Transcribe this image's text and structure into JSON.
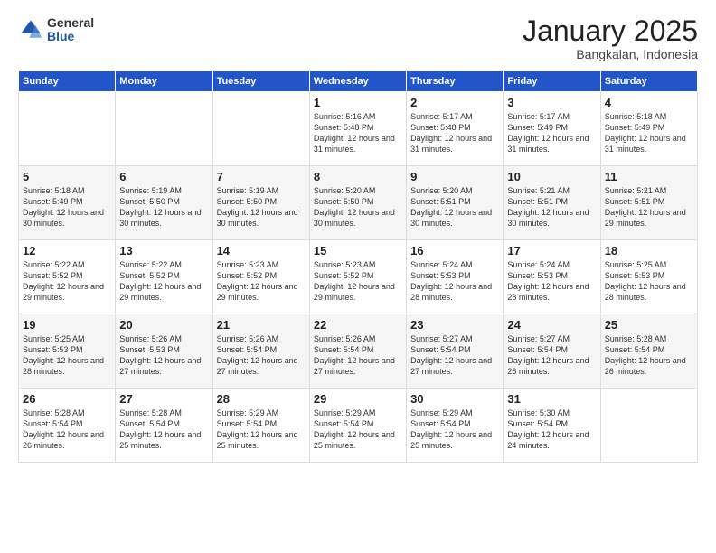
{
  "header": {
    "logo_general": "General",
    "logo_blue": "Blue",
    "title": "January 2025",
    "subtitle": "Bangkalan, Indonesia"
  },
  "weekdays": [
    "Sunday",
    "Monday",
    "Tuesday",
    "Wednesday",
    "Thursday",
    "Friday",
    "Saturday"
  ],
  "weeks": [
    [
      {
        "day": "",
        "info": ""
      },
      {
        "day": "",
        "info": ""
      },
      {
        "day": "",
        "info": ""
      },
      {
        "day": "1",
        "info": "Sunrise: 5:16 AM\nSunset: 5:48 PM\nDaylight: 12 hours\nand 31 minutes."
      },
      {
        "day": "2",
        "info": "Sunrise: 5:17 AM\nSunset: 5:48 PM\nDaylight: 12 hours\nand 31 minutes."
      },
      {
        "day": "3",
        "info": "Sunrise: 5:17 AM\nSunset: 5:49 PM\nDaylight: 12 hours\nand 31 minutes."
      },
      {
        "day": "4",
        "info": "Sunrise: 5:18 AM\nSunset: 5:49 PM\nDaylight: 12 hours\nand 31 minutes."
      }
    ],
    [
      {
        "day": "5",
        "info": "Sunrise: 5:18 AM\nSunset: 5:49 PM\nDaylight: 12 hours\nand 30 minutes."
      },
      {
        "day": "6",
        "info": "Sunrise: 5:19 AM\nSunset: 5:50 PM\nDaylight: 12 hours\nand 30 minutes."
      },
      {
        "day": "7",
        "info": "Sunrise: 5:19 AM\nSunset: 5:50 PM\nDaylight: 12 hours\nand 30 minutes."
      },
      {
        "day": "8",
        "info": "Sunrise: 5:20 AM\nSunset: 5:50 PM\nDaylight: 12 hours\nand 30 minutes."
      },
      {
        "day": "9",
        "info": "Sunrise: 5:20 AM\nSunset: 5:51 PM\nDaylight: 12 hours\nand 30 minutes."
      },
      {
        "day": "10",
        "info": "Sunrise: 5:21 AM\nSunset: 5:51 PM\nDaylight: 12 hours\nand 30 minutes."
      },
      {
        "day": "11",
        "info": "Sunrise: 5:21 AM\nSunset: 5:51 PM\nDaylight: 12 hours\nand 29 minutes."
      }
    ],
    [
      {
        "day": "12",
        "info": "Sunrise: 5:22 AM\nSunset: 5:52 PM\nDaylight: 12 hours\nand 29 minutes."
      },
      {
        "day": "13",
        "info": "Sunrise: 5:22 AM\nSunset: 5:52 PM\nDaylight: 12 hours\nand 29 minutes."
      },
      {
        "day": "14",
        "info": "Sunrise: 5:23 AM\nSunset: 5:52 PM\nDaylight: 12 hours\nand 29 minutes."
      },
      {
        "day": "15",
        "info": "Sunrise: 5:23 AM\nSunset: 5:52 PM\nDaylight: 12 hours\nand 29 minutes."
      },
      {
        "day": "16",
        "info": "Sunrise: 5:24 AM\nSunset: 5:53 PM\nDaylight: 12 hours\nand 28 minutes."
      },
      {
        "day": "17",
        "info": "Sunrise: 5:24 AM\nSunset: 5:53 PM\nDaylight: 12 hours\nand 28 minutes."
      },
      {
        "day": "18",
        "info": "Sunrise: 5:25 AM\nSunset: 5:53 PM\nDaylight: 12 hours\nand 28 minutes."
      }
    ],
    [
      {
        "day": "19",
        "info": "Sunrise: 5:25 AM\nSunset: 5:53 PM\nDaylight: 12 hours\nand 28 minutes."
      },
      {
        "day": "20",
        "info": "Sunrise: 5:26 AM\nSunset: 5:53 PM\nDaylight: 12 hours\nand 27 minutes."
      },
      {
        "day": "21",
        "info": "Sunrise: 5:26 AM\nSunset: 5:54 PM\nDaylight: 12 hours\nand 27 minutes."
      },
      {
        "day": "22",
        "info": "Sunrise: 5:26 AM\nSunset: 5:54 PM\nDaylight: 12 hours\nand 27 minutes."
      },
      {
        "day": "23",
        "info": "Sunrise: 5:27 AM\nSunset: 5:54 PM\nDaylight: 12 hours\nand 27 minutes."
      },
      {
        "day": "24",
        "info": "Sunrise: 5:27 AM\nSunset: 5:54 PM\nDaylight: 12 hours\nand 26 minutes."
      },
      {
        "day": "25",
        "info": "Sunrise: 5:28 AM\nSunset: 5:54 PM\nDaylight: 12 hours\nand 26 minutes."
      }
    ],
    [
      {
        "day": "26",
        "info": "Sunrise: 5:28 AM\nSunset: 5:54 PM\nDaylight: 12 hours\nand 26 minutes."
      },
      {
        "day": "27",
        "info": "Sunrise: 5:28 AM\nSunset: 5:54 PM\nDaylight: 12 hours\nand 25 minutes."
      },
      {
        "day": "28",
        "info": "Sunrise: 5:29 AM\nSunset: 5:54 PM\nDaylight: 12 hours\nand 25 minutes."
      },
      {
        "day": "29",
        "info": "Sunrise: 5:29 AM\nSunset: 5:54 PM\nDaylight: 12 hours\nand 25 minutes."
      },
      {
        "day": "30",
        "info": "Sunrise: 5:29 AM\nSunset: 5:54 PM\nDaylight: 12 hours\nand 25 minutes."
      },
      {
        "day": "31",
        "info": "Sunrise: 5:30 AM\nSunset: 5:54 PM\nDaylight: 12 hours\nand 24 minutes."
      },
      {
        "day": "",
        "info": ""
      }
    ]
  ]
}
